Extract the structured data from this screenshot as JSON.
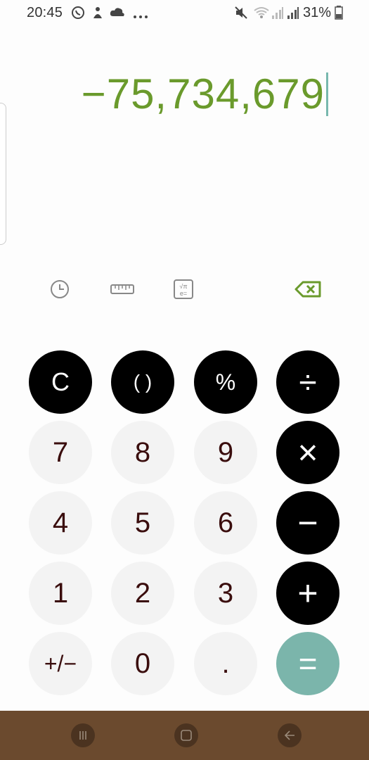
{
  "status_bar": {
    "time": "20:45",
    "icons": [
      "whatsapp-icon",
      "notification-icon",
      "cloud-icon",
      "more-dots-icon"
    ],
    "right_icons": [
      "mute-icon",
      "wifi-icon",
      "signal-icon",
      "signal-icon-2",
      "battery-icon"
    ],
    "battery": "31%"
  },
  "display": {
    "expression": "−75,734,679",
    "color": "#6a9a2c"
  },
  "toolbar": {
    "items": [
      "history-icon",
      "unit-converter-icon",
      "scientific-mode-icon",
      "backspace-icon"
    ],
    "backspace_color": "#6a9a2c"
  },
  "keypad": {
    "row1": [
      "C",
      "( )",
      "%",
      "÷"
    ],
    "row2": [
      "7",
      "8",
      "9",
      "×"
    ],
    "row3": [
      "4",
      "5",
      "6",
      "−"
    ],
    "row4": [
      "1",
      "2",
      "3",
      "+"
    ],
    "row5": [
      "+/−",
      "0",
      ".",
      "="
    ]
  },
  "nav_bar": {
    "buttons": [
      "recent-apps-icon",
      "home-icon",
      "back-icon"
    ],
    "color": "#6b4a2e"
  }
}
